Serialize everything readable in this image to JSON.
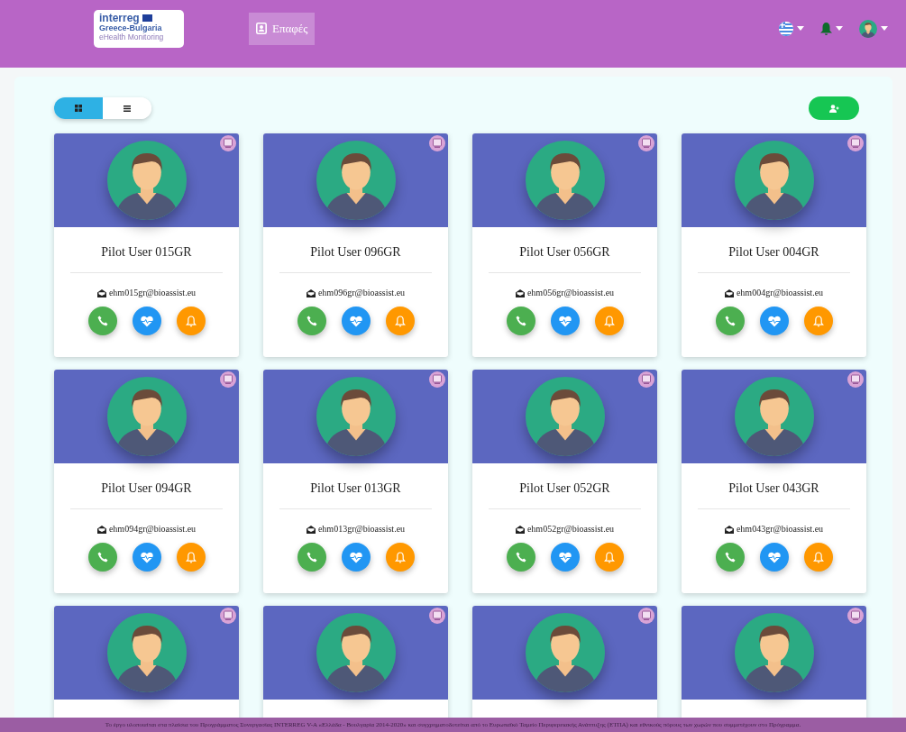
{
  "header": {
    "logo": {
      "title": "interreg",
      "subtitle": "Greece-Bulgaria",
      "tagline": "eHealth Monitoring"
    },
    "nav": [
      {
        "label": "Επαφές",
        "selected": true
      }
    ]
  },
  "view_toggle": [
    {
      "kind": "grid",
      "selected": true
    },
    {
      "kind": "list",
      "selected": false
    }
  ],
  "contacts": [
    {
      "kind": "full",
      "name": "Pilot User 015GR",
      "email": "ehm015gr@bioassist.eu"
    },
    {
      "kind": "full",
      "name": "Pilot User 096GR",
      "email": "ehm096gr@bioassist.eu"
    },
    {
      "kind": "full",
      "name": "Pilot User 056GR",
      "email": "ehm056gr@bioassist.eu"
    },
    {
      "kind": "full",
      "name": "Pilot User 004GR",
      "email": "ehm004gr@bioassist.eu"
    },
    {
      "kind": "full",
      "name": "Pilot User 094GR",
      "email": "ehm094gr@bioassist.eu"
    },
    {
      "kind": "full",
      "name": "Pilot User 013GR",
      "email": "ehm013gr@bioassist.eu"
    },
    {
      "kind": "full",
      "name": "Pilot User 052GR",
      "email": "ehm052gr@bioassist.eu"
    },
    {
      "kind": "full",
      "name": "Pilot User 043GR",
      "email": "ehm043gr@bioassist.eu"
    },
    {
      "kind": "cut"
    },
    {
      "kind": "cut"
    },
    {
      "kind": "cut"
    },
    {
      "kind": "cut"
    }
  ],
  "footer": "Το έργο υλοποιείται στα πλαίσια του Προγράμματος Συνεργασίας INTERREG V-A «Ελλάδα - Βουλγαρία 2014-2020» και συγχρηματοδοτείται από το Ευρωπαϊκό Ταμείο Περιφερειακής Ανάπτυξης (ΕΤΠΑ) και εθνικούς πόρους των χωρών που συμμετέχουν στο Πρόγραμμα."
}
